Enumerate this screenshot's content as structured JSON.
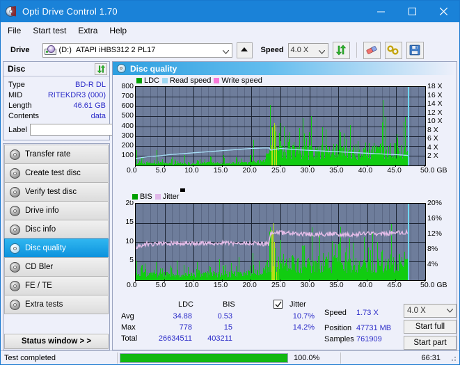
{
  "window": {
    "title": "Opti Drive Control 1.70",
    "icon": "optical-disc-icon",
    "minimize": "minimize",
    "maximize": "maximize",
    "close": "close"
  },
  "menu": {
    "items": [
      "File",
      "Start test",
      "Extra",
      "Help"
    ]
  },
  "toolbar": {
    "drive_label": "Drive",
    "drive_letter": "(D:)",
    "drive_name": "ATAPI iHBS312  2 PL17",
    "eject_tooltip": "Eject",
    "speed_label": "Speed",
    "speed_value": "4.0 X",
    "refresh_icon": "refresh-icon",
    "erase_icon": "eraser-icon",
    "tools_icon": "tools-icon",
    "save_icon": "save-icon"
  },
  "disc": {
    "panel_title": "Disc",
    "refresh_icon": "refresh-icon",
    "rows": [
      {
        "key": "Type",
        "value": "BD-R DL"
      },
      {
        "key": "MID",
        "value": "RITEKDR3 (000)"
      },
      {
        "key": "Length",
        "value": "46.61 GB"
      },
      {
        "key": "Contents",
        "value": "data"
      }
    ],
    "label_key": "Label",
    "label_value": "",
    "label_button_icon": "disc-icon"
  },
  "sidebar": {
    "items": [
      {
        "label": "Transfer rate",
        "selected": false
      },
      {
        "label": "Create test disc",
        "selected": false
      },
      {
        "label": "Verify test disc",
        "selected": false
      },
      {
        "label": "Drive info",
        "selected": false
      },
      {
        "label": "Disc info",
        "selected": false
      },
      {
        "label": "Disc quality",
        "selected": true
      },
      {
        "label": "CD Bler",
        "selected": false
      },
      {
        "label": "FE / TE",
        "selected": false
      },
      {
        "label": "Extra tests",
        "selected": false
      }
    ],
    "status_window": "Status window > >"
  },
  "main": {
    "header_title": "Disc quality",
    "header_icon": "disc-quality-icon"
  },
  "stats": {
    "col_ldc": "LDC",
    "col_bis": "BIS",
    "row_avg": "Avg",
    "row_max": "Max",
    "row_total": "Total",
    "ldc_avg": "34.88",
    "ldc_max": "778",
    "ldc_total": "26634511",
    "bis_avg": "0.53",
    "bis_max": "15",
    "bis_total": "403211",
    "jitter_label": "Jitter",
    "jitter_checked": true,
    "jitter_avg": "10.7%",
    "jitter_max": "14.2%",
    "speed_label": "Speed",
    "speed_value": "1.73 X",
    "position_label": "Position",
    "position_value": "47731 MB",
    "samples_label": "Samples",
    "samples_value": "761909",
    "speed_select": "4.0 X",
    "start_full": "Start full",
    "start_part": "Start part"
  },
  "statusbar": {
    "message": "Test completed",
    "percent_label": "100.0%",
    "percent_value": 100,
    "elapsed": "66:31"
  },
  "chart_data": [
    {
      "type": "area",
      "name": "ldc-chart",
      "title": "",
      "xlabel": "GB",
      "ylabel": "",
      "xlim": [
        0,
        50
      ],
      "ylim": [
        0,
        800
      ],
      "y2lim": [
        0,
        18
      ],
      "xticks": [
        "0.0",
        "5.0",
        "10.0",
        "15.0",
        "20.0",
        "25.0",
        "30.0",
        "35.0",
        "40.0",
        "45.0",
        "50.0 GB"
      ],
      "yticks": [
        "100",
        "200",
        "300",
        "400",
        "500",
        "600",
        "700",
        "800"
      ],
      "y2ticks": [
        "2 X",
        "4 X",
        "6 X",
        "8 X",
        "10 X",
        "12 X",
        "14 X",
        "16 X",
        "18 X"
      ],
      "grid": true,
      "legend": [
        {
          "label": "LDC",
          "color": "#00a000"
        },
        {
          "label": "Read speed",
          "color": "#9fd8f2"
        },
        {
          "label": "Write speed",
          "color": "#f878d8"
        }
      ],
      "data_end_gb": 47.0,
      "layer_break_gb": 23.2,
      "series": [
        {
          "name": "LDC",
          "color": "#11cc11",
          "note": "error spikes per GB; low on layer 0, heavy after layer break",
          "baseline": [
            30,
            28,
            26,
            30,
            34,
            28,
            26,
            25,
            27,
            30,
            28,
            26,
            30,
            33,
            29,
            27,
            30,
            32,
            30,
            34,
            38,
            42,
            48,
            120,
            210,
            190,
            175,
            165,
            170,
            160,
            158,
            162,
            168,
            172,
            180,
            175,
            168,
            164,
            170,
            176,
            182,
            178,
            174,
            180,
            186,
            190,
            188,
            0,
            0,
            0
          ],
          "peaks_gb": [
            0.1,
            1.2,
            3.6,
            6.2,
            8.4,
            10.6,
            12.9,
            15.2,
            17.4,
            19.8,
            20.3,
            22.5,
            23.2,
            23.6,
            24.1,
            24.8,
            25.6,
            26.4,
            27.2,
            29.1,
            30.2,
            31.6,
            33.4,
            35.1,
            36.3,
            38.0,
            39.4,
            41.2,
            42.6,
            44.0,
            45.2,
            46.3
          ],
          "peaks_value": [
            160,
            95,
            205,
            80,
            120,
            70,
            95,
            105,
            85,
            110,
            330,
            140,
            778,
            520,
            430,
            455,
            390,
            300,
            260,
            360,
            230,
            250,
            210,
            420,
            290,
            240,
            200,
            230,
            215,
            260,
            245,
            220
          ]
        },
        {
          "name": "Read speed",
          "color": "#a8e0f8",
          "note": "CAV ramp up on layer 0, then falls across layer 1",
          "x": [
            0,
            2,
            4,
            6,
            8,
            10,
            12,
            14,
            16,
            18,
            20,
            22,
            23.1,
            23.3,
            25,
            28,
            31,
            34,
            37,
            40,
            43,
            46,
            47
          ],
          "y_speed_x": [
            1.6,
            2.0,
            2.2,
            2.5,
            2.7,
            2.9,
            3.1,
            3.3,
            3.5,
            3.7,
            3.9,
            4.0,
            4.0,
            3.5,
            3.9,
            3.6,
            3.4,
            3.2,
            3.0,
            2.8,
            2.6,
            2.4,
            2.3
          ]
        },
        {
          "name": "Write speed",
          "color": "#f878d8",
          "x": [],
          "y_speed_x": []
        }
      ]
    },
    {
      "type": "area",
      "name": "bis-jitter-chart",
      "title": "",
      "xlabel": "GB",
      "xlim": [
        0,
        50
      ],
      "ylim": [
        0,
        20
      ],
      "y2lim": [
        0,
        20
      ],
      "xticks": [
        "0.0",
        "5.0",
        "10.0",
        "15.0",
        "20.0",
        "25.0",
        "30.0",
        "35.0",
        "40.0",
        "45.0",
        "50.0 GB"
      ],
      "yticks": [
        "5",
        "10",
        "15",
        "20"
      ],
      "y2ticks": [
        "4%",
        "8%",
        "12%",
        "16%",
        "20%"
      ],
      "grid": true,
      "legend": [
        {
          "label": "BIS",
          "color": "#00a000"
        },
        {
          "label": "Jitter",
          "color": "#e0b8e8"
        }
      ],
      "data_end_gb": 47.0,
      "layer_break_gb": 23.2,
      "series": [
        {
          "name": "BIS",
          "color": "#11cc11",
          "baseline": [
            2.0,
            1.8,
            1.6,
            1.7,
            1.9,
            1.7,
            1.6,
            1.5,
            1.7,
            1.8,
            1.7,
            1.6,
            1.8,
            1.9,
            1.7,
            1.6,
            1.8,
            1.9,
            1.8,
            2.0,
            2.2,
            2.4,
            2.6,
            4.6,
            5.2,
            5.0,
            4.8,
            4.6,
            4.8,
            4.5,
            4.4,
            4.6,
            4.7,
            4.8,
            5.0,
            4.9,
            4.6,
            4.5,
            4.7,
            4.9,
            5.0,
            4.8,
            4.7,
            4.9,
            5.1,
            5.2,
            5.0,
            0,
            0,
            0
          ],
          "peaks_gb": [
            0.1,
            1.0,
            3.5,
            6.1,
            8.3,
            10.5,
            12.8,
            15.1,
            17.3,
            19.7,
            20.2,
            22.4,
            23.1,
            23.5,
            24.0,
            25.5,
            27.0,
            29.0,
            31.5,
            33.3,
            35.0,
            36.2,
            38.0,
            40.5,
            42.5,
            44.0,
            45.5,
            46.4
          ],
          "peaks_value": [
            5.0,
            4.0,
            4.8,
            3.6,
            4.2,
            3.4,
            3.8,
            4.0,
            3.6,
            4.0,
            8.0,
            5.0,
            15.0,
            13.0,
            11.5,
            9.0,
            8.0,
            9.5,
            8.5,
            8.0,
            12.0,
            9.0,
            8.0,
            8.5,
            8.0,
            9.0,
            8.5,
            8.0
          ]
        },
        {
          "name": "Jitter",
          "color": "#e4bce8",
          "note": "percent scale on right axis",
          "x": [
            0,
            0.5,
            2,
            4,
            6,
            8,
            10,
            12,
            14,
            16,
            18,
            20,
            22,
            23.0,
            23.3,
            25,
            28,
            31,
            34,
            37,
            40,
            43,
            45,
            46.5,
            47
          ],
          "y_percent": [
            8.6,
            9.0,
            9.5,
            9.5,
            9.6,
            9.7,
            9.7,
            9.7,
            9.7,
            9.6,
            9.6,
            9.6,
            9.5,
            9.5,
            12.6,
            12.4,
            12.1,
            12.0,
            12.1,
            12.0,
            12.1,
            12.2,
            12.4,
            12.6,
            12.3
          ]
        }
      ]
    }
  ]
}
